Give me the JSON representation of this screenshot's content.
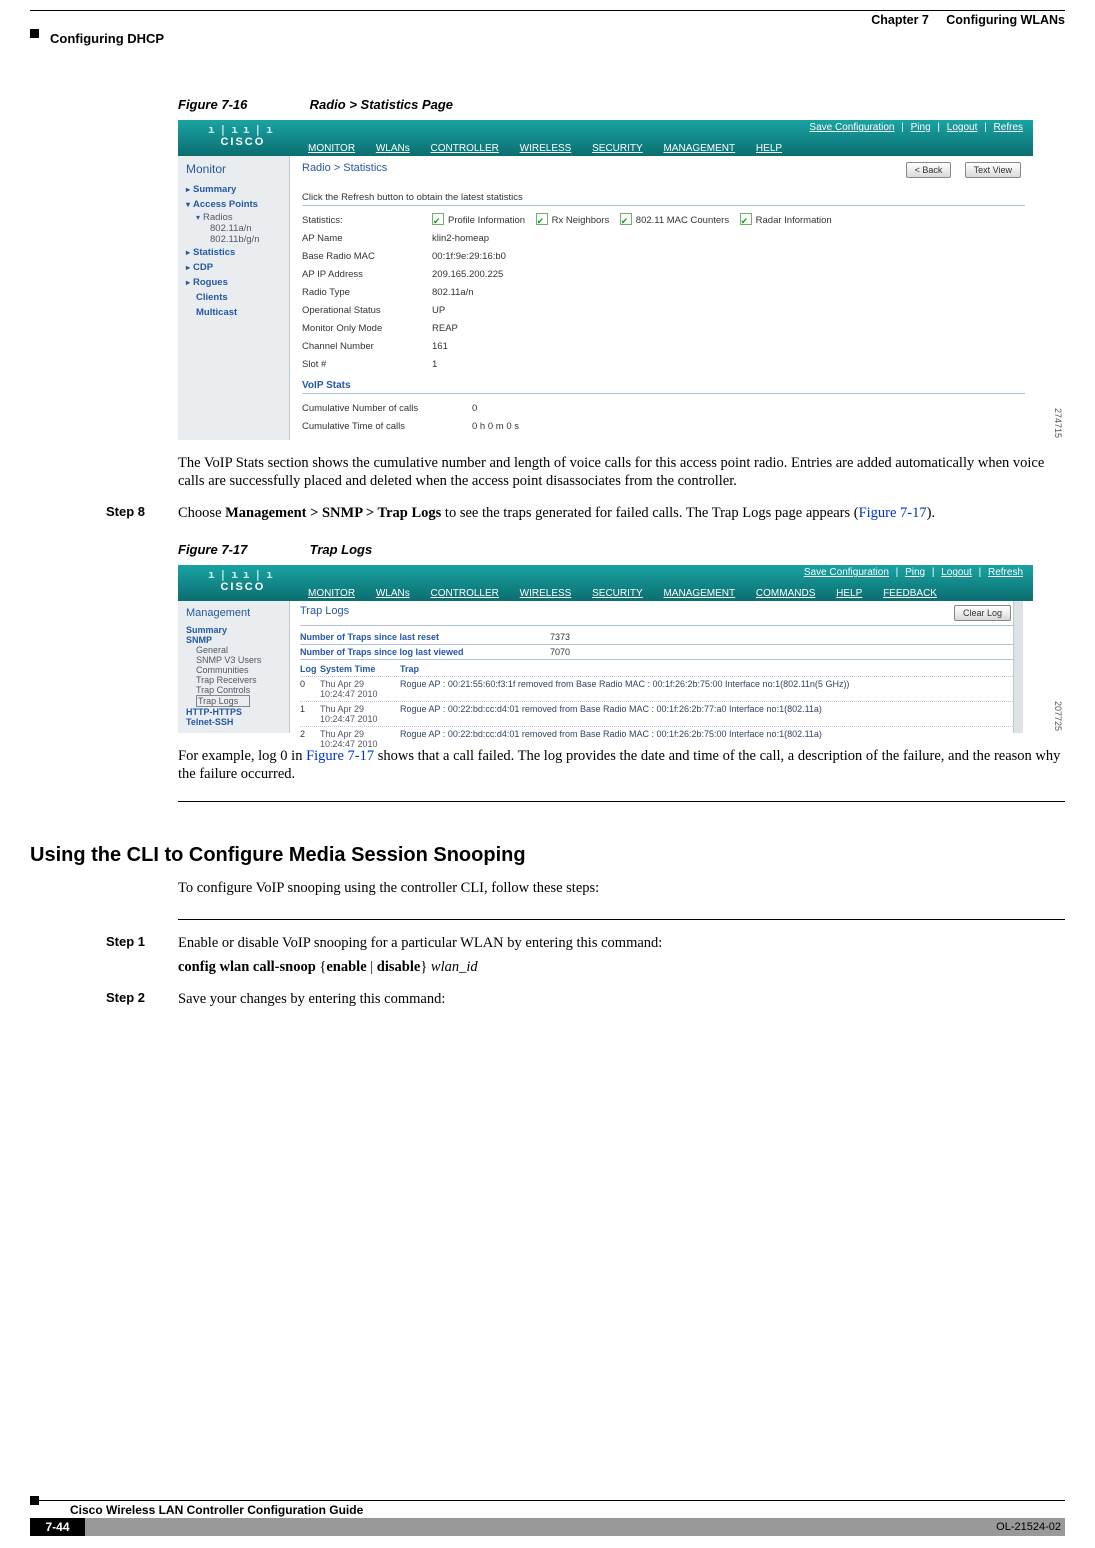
{
  "header": {
    "chapter_label": "Chapter 7",
    "chapter_title": "Configuring WLANs",
    "section": "Configuring DHCP"
  },
  "fig1": {
    "num": "Figure 7-16",
    "title": "Radio > Statistics Page",
    "imgnum": "274715",
    "toplinks": {
      "save": "Save Configuration",
      "ping": "Ping",
      "logout": "Logout",
      "refresh": "Refres"
    },
    "nav": [
      "MONITOR",
      "WLANs",
      "CONTROLLER",
      "WIRELESS",
      "SECURITY",
      "MANAGEMENT",
      "HELP"
    ],
    "side_title": "Monitor",
    "side": {
      "summary": "Summary",
      "ap": "Access Points",
      "radios": "Radios",
      "r1": "802.11a/n",
      "r2": "802.11b/g/n",
      "stats": "Statistics",
      "cdp": "CDP",
      "rogues": "Rogues",
      "clients": "Clients",
      "multicast": "Multicast"
    },
    "crumb": "Radio > Statistics",
    "btn_back": "< Back",
    "btn_text": "Text View",
    "instr": "Click the Refresh button to obtain the latest statistics",
    "cbx": [
      "Profile Information",
      "Rx Neighbors",
      "802.11 MAC Counters",
      "Radar Information"
    ],
    "kv": [
      {
        "k": "Statistics:",
        "v": ""
      },
      {
        "k": "AP Name",
        "v": "klin2-homeap"
      },
      {
        "k": "Base Radio MAC",
        "v": "00:1f:9e:29:16:b0"
      },
      {
        "k": "AP IP Address",
        "v": "209.165.200.225"
      },
      {
        "k": "Radio Type",
        "v": "802.11a/n"
      },
      {
        "k": "Operational Status",
        "v": "UP"
      },
      {
        "k": "Monitor Only Mode",
        "v": "REAP"
      },
      {
        "k": "Channel Number",
        "v": "161"
      },
      {
        "k": "Slot #",
        "v": "1"
      }
    ],
    "voip_title": "VoIP Stats",
    "voip": [
      {
        "k": "Cumulative Number of calls",
        "v": "0"
      },
      {
        "k": "Cumulative Time of calls",
        "v": "0 h 0 m 0 s"
      }
    ]
  },
  "para1": "The VoIP Stats section shows the cumulative number and length of voice calls for this access point radio. Entries are added automatically when voice calls are successfully placed and deleted when the access point disassociates from the controller.",
  "step8": {
    "label": "Step 8",
    "pre": "Choose ",
    "bold": "Management > SNMP > Trap Logs",
    "mid": " to see the traps generated for failed calls. The Trap Logs page appears (",
    "link": "Figure 7-17",
    "post": ")."
  },
  "fig2": {
    "num": "Figure 7-17",
    "title": "Trap Logs",
    "imgnum": "207725",
    "toplinks": {
      "save": "Save Configuration",
      "ping": "Ping",
      "logout": "Logout",
      "refresh": "Refresh"
    },
    "nav": [
      "MONITOR",
      "WLANs",
      "CONTROLLER",
      "WIRELESS",
      "SECURITY",
      "MANAGEMENT",
      "COMMANDS",
      "HELP",
      "FEEDBACK"
    ],
    "side_title": "Management",
    "side": {
      "summary": "Summary",
      "snmp": "SNMP",
      "general": "General",
      "users": "SNMP V3 Users",
      "comm": "Communities",
      "recv": "Trap Receivers",
      "ctrl": "Trap Controls",
      "logs": "Trap Logs",
      "http": "HTTP-HTTPS",
      "telnet": "Telnet-SSH"
    },
    "clear": "Clear Log",
    "nreset_l": "Number of Traps since last reset",
    "nreset_v": "7373",
    "nview_l": "Number of Traps since log last viewed",
    "nview_v": "7070",
    "cols": {
      "log": "Log",
      "time": "System Time",
      "trap": "Trap"
    },
    "rows": [
      {
        "log": "0",
        "time": "Thu Apr 29 10:24:47 2010",
        "trap": "Rogue AP : 00:21:55:60:f3:1f removed from Base Radio MAC : 00:1f:26:2b:75:00 Interface no:1(802.11n(5 GHz))"
      },
      {
        "log": "1",
        "time": "Thu Apr 29 10:24:47 2010",
        "trap": "Rogue AP : 00:22:bd:cc:d4:01 removed from Base Radio MAC : 00:1f:26:2b:77:a0 Interface no:1(802.11a)"
      },
      {
        "log": "2",
        "time": "Thu Apr 29 10:24:47 2010",
        "trap": "Rogue AP : 00:22:bd:cc:d4:01 removed from Base Radio MAC : 00:1f:26:2b:75:00 Interface no:1(802.11a)"
      }
    ]
  },
  "para2_pre": "For example, log 0 in ",
  "para2_link": "Figure 7-17",
  "para2_post": " shows that a call failed. The log provides the date and time of the call, a description of the failure, and the reason why the failure occurred.",
  "h3": "Using the CLI to Configure Media Session Snooping",
  "para3": "To configure VoIP snooping using the controller CLI, follow these steps:",
  "step1": {
    "label": "Step 1",
    "line1": "Enable or disable VoIP snooping for a particular WLAN by entering this command:",
    "cmd_pre": "config wlan call-snoop ",
    "cmd_br1": "{",
    "cmd_en": "enable",
    "cmd_pipe": " | ",
    "cmd_dis": "disable",
    "cmd_br2": "} ",
    "cmd_arg": "wlan_id"
  },
  "step2": {
    "label": "Step 2",
    "line1": "Save your changes by entering this command:"
  },
  "footer": {
    "title": "Cisco Wireless LAN Controller Configuration Guide",
    "page": "7-44",
    "ol": "OL-21524-02"
  }
}
